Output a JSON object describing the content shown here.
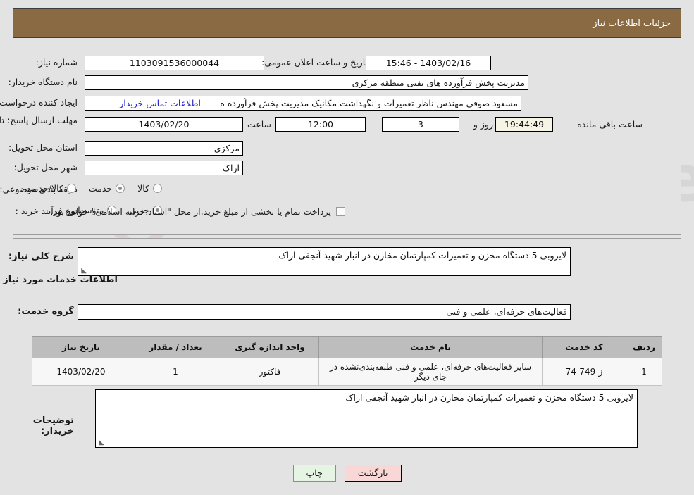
{
  "header": {
    "title": "جزئیات اطلاعات نیاز"
  },
  "form": {
    "need_number_label": "شماره نیاز:",
    "need_number_value": "1103091536000044",
    "announce_label": "تاریخ و ساعت اعلان عمومی:",
    "announce_value": "1403/02/16 - 15:46",
    "buyer_org_label": "نام دستگاه خریدار:",
    "buyer_org_value": "مدیریت پخش فرآورده های نفتی منطقه مرکزی",
    "requester_label": "ایجاد کننده درخواست:",
    "requester_value": "مسعود صوفی مهندس ناظر تعمیرات و نگهداشت مکانیک مدیریت پخش فرآورده ه",
    "buyer_contact_link": "اطلاعات تماس خریدار",
    "deadline_label": "مهلت ارسال پاسخ: تا تاریخ:",
    "deadline_date": "1403/02/20",
    "hour_label": "ساعت",
    "deadline_time": "12:00",
    "remain_days": "3",
    "remain_days_label": "روز و",
    "remain_clock": "19:44:49",
    "remain_suffix": "ساعت باقی مانده",
    "province_label": "استان محل تحویل:",
    "province_value": "مرکزی",
    "city_label": "شهر محل تحویل:",
    "city_value": "اراک",
    "category_label": "طبقه بندی موضوعی:",
    "category_options": [
      {
        "label": "کالا",
        "selected": false
      },
      {
        "label": "خدمت",
        "selected": true
      },
      {
        "label": "کالا/خدمت",
        "selected": false
      }
    ],
    "process_label": "نوع فرآیند خرید :",
    "process_options": [
      {
        "label": "جزیی",
        "selected": true
      },
      {
        "label": "متوسط",
        "selected": false
      }
    ],
    "treasury_checkbox_text": "پرداخت تمام یا بخشی از مبلغ خرید،از محل \"اسناد خزانه اسلامی\" خواهد بود.",
    "treasury_checked": false
  },
  "details": {
    "general_desc_label": "شرح کلی نیاز:",
    "general_desc_value": "لایروبی 5 دستگاه مخزن و تعمیرات کمپارتمان مخازن در انبار شهید آنجفی اراک",
    "services_section_title": "اطلاعات خدمات مورد نیاز",
    "service_group_label": "گروه خدمت:",
    "service_group_value": "فعالیت‌های حرفه‌ای، علمی و فنی",
    "buyer_notes_label": "توضیحات خریدار:",
    "buyer_notes_value": "لایروبی 5 دستگاه مخزن و تعمیرات کمپارتمان مخازن در انبار شهید آنجفی اراک"
  },
  "table": {
    "columns": [
      "ردیف",
      "کد خدمت",
      "نام خدمت",
      "واحد اندازه گیری",
      "تعداد / مقدار",
      "تاریخ نیاز"
    ],
    "rows": [
      {
        "radif": "1",
        "code": "ز-749-74",
        "name": "سایر فعالیت‌های حرفه‌ای، علمی و فنی طبقه‌بندی‌نشده در جای دیگر",
        "unit": "فاکتور",
        "qty": "1",
        "date": "1403/02/20"
      }
    ]
  },
  "buttons": {
    "print": "چاپ",
    "back": "بازگشت"
  },
  "watermark": {
    "text": "AriaTender.net"
  }
}
